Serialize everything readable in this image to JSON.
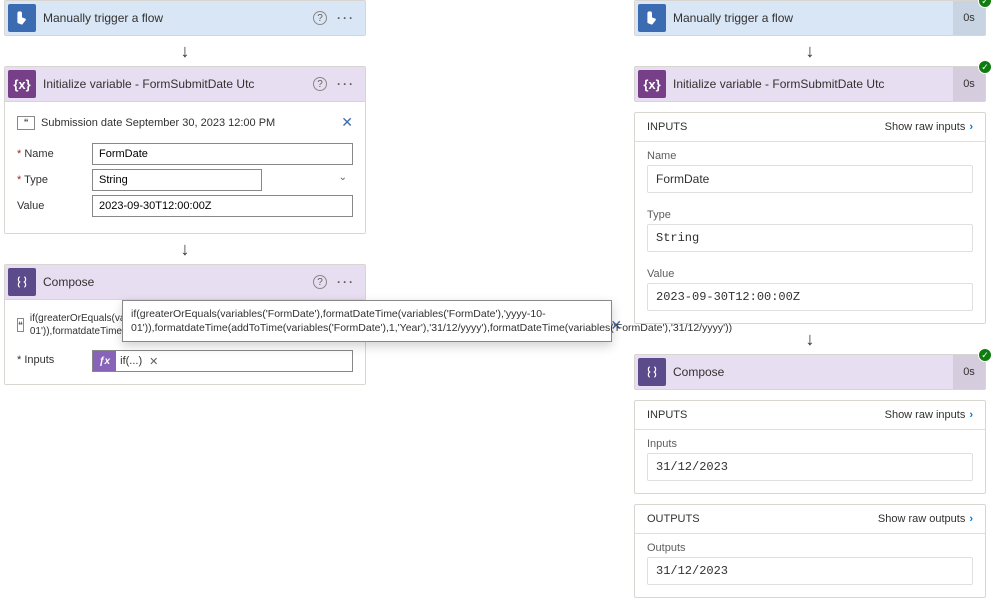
{
  "left": {
    "trigger": {
      "title": "Manually trigger a flow"
    },
    "initVar": {
      "title": "Initialize variable - FormSubmitDate Utc",
      "description": "Submission date September 30, 2023 12:00 PM",
      "name_label": "Name",
      "name_value": "FormDate",
      "type_label": "Type",
      "type_value": "String",
      "value_label": "Value",
      "value_value": "2023-09-30T12:00:00Z"
    },
    "compose": {
      "title": "Compose",
      "description": "if(greaterOrEquals(variables('FormDate'),formatDateTime(variables('FormDate'),'yyyy-10-01')),formatdateTime(addToTime(variables('FormDate'),1,'Year'),'31/12/yyyy'),formatDateTime(variables('FormDate'),'31/12/yyyy'))",
      "inputs_label": "Inputs",
      "token_text": "if(...)"
    },
    "tooltip_text": "if(greaterOrEquals(variables('FormDate'),formatDateTime(variables('FormDate'),'yyyy-10-01')),formatdateTime(addToTime(variables('FormDate'),1,'Year'),'31/12/yyyy'),formatDateTime(variables('FormDate'),'31/12/yyyy'))"
  },
  "right": {
    "trigger": {
      "title": "Manually trigger a flow",
      "badge": "0s"
    },
    "initVar": {
      "title": "Initialize variable - FormSubmitDate Utc",
      "badge": "0s",
      "inputs_section": "INPUTS",
      "show_raw_inputs": "Show raw inputs",
      "name_label": "Name",
      "name_value": "FormDate",
      "type_label": "Type",
      "type_value": "String",
      "value_label": "Value",
      "value_value": "2023-09-30T12:00:00Z"
    },
    "compose": {
      "title": "Compose",
      "badge": "0s",
      "inputs_section": "INPUTS",
      "show_raw_inputs": "Show raw inputs",
      "inputs_label": "Inputs",
      "inputs_value": "31/12/2023",
      "outputs_section": "OUTPUTS",
      "show_raw_outputs": "Show raw outputs",
      "outputs_label": "Outputs",
      "outputs_value": "31/12/2023"
    }
  }
}
